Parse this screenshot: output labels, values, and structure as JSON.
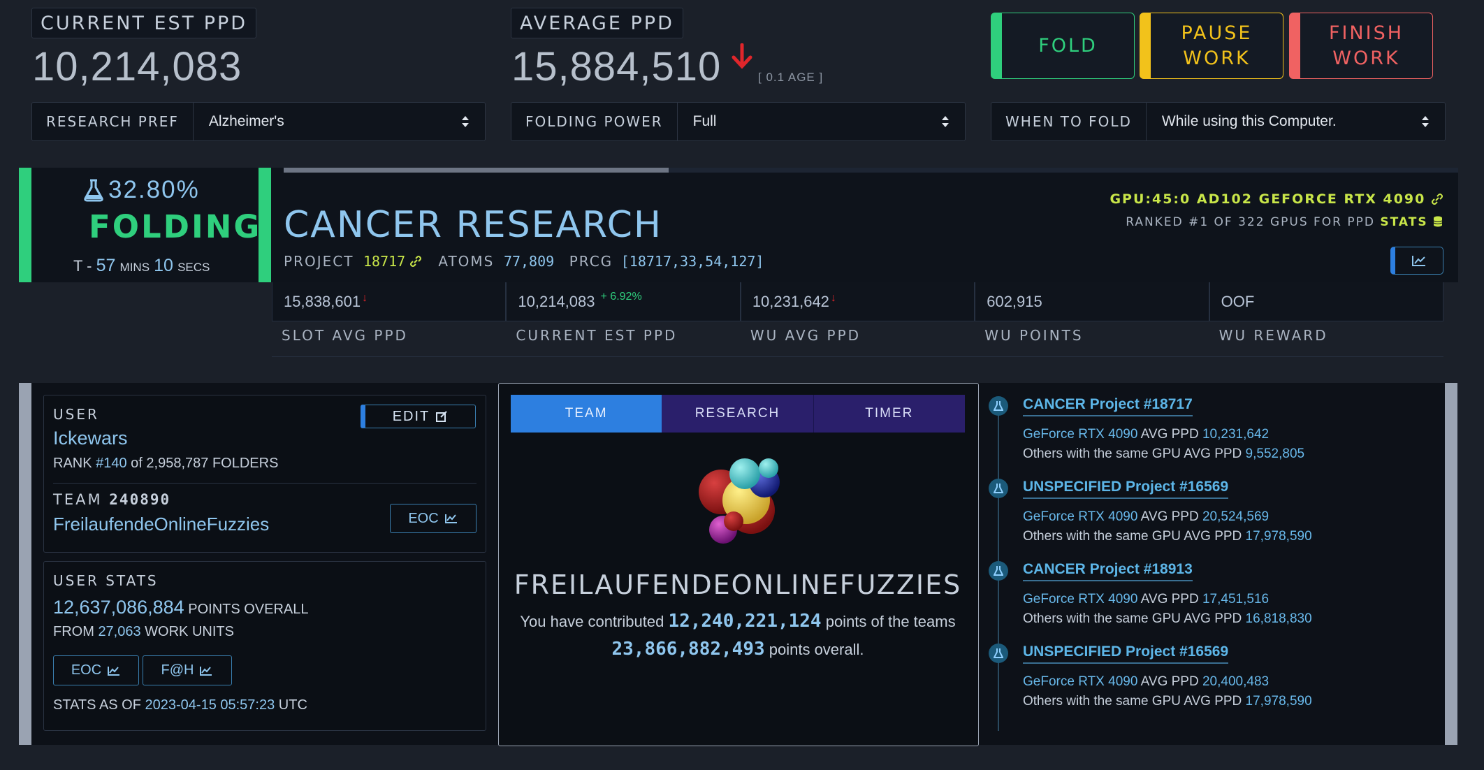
{
  "header": {
    "current_est_ppd_label": "CURRENT EST PPD",
    "current_est_ppd_value": "10,214,083",
    "average_ppd_label": "AVERAGE PPD",
    "average_ppd_value": "15,884,510",
    "average_age": "[ 0.1 AGE ]",
    "research_pref_label": "RESEARCH PREF",
    "research_pref_value": "Alzheimer's",
    "folding_power_label": "FOLDING POWER",
    "folding_power_value": "Full",
    "when_to_fold_label": "WHEN TO FOLD",
    "when_to_fold_value": "While using this Computer."
  },
  "controls": {
    "fold": "FOLD",
    "pause": "PAUSE WORK",
    "finish": "FINISH WORK"
  },
  "status": {
    "percent": "32.80%",
    "state": "FOLDING",
    "eta_prefix": "T - ",
    "eta_mins": "57",
    "eta_mins_unit": "MINS",
    "eta_secs": "10",
    "eta_secs_unit": "SECS",
    "progress_fraction": 0.328
  },
  "research": {
    "title": "CANCER RESEARCH",
    "project_label": "PROJECT",
    "project_value": "18717",
    "atoms_label": "ATOMS",
    "atoms_value": "77,809",
    "prcg_label": "PRCG",
    "prcg_value": "[18717,33,54,127]",
    "gpu": "GPU:45:0 AD102 GEFORCE RTX 4090",
    "ranked": "RANKED #1 OF 322 GPUS FOR PPD",
    "stats_link": "STATS"
  },
  "slot_stats": {
    "values": [
      "15,838,601",
      "10,214,083",
      "10,231,642",
      "602,915",
      "OOF"
    ],
    "current_change": "+ 6.92%",
    "labels": [
      "SLOT AVG PPD",
      "CURRENT EST PPD",
      "WU AVG PPD",
      "WU POINTS",
      "WU REWARD"
    ]
  },
  "user": {
    "title": "USER",
    "edit": "EDIT",
    "name": "Ickewars",
    "rank_prefix": "RANK ",
    "rank_value": "#140",
    "rank_suffix": " of 2,958,787 FOLDERS",
    "team_label": "TEAM",
    "team_id": "240890",
    "team_name": "FreilaufendeOnlineFuzzies",
    "eoc": "EOC"
  },
  "user_stats": {
    "title": "USER STATS",
    "points": "12,637,086,884",
    "points_suffix": " POINTS OVERALL",
    "from_prefix": "FROM ",
    "work_units": "27,063",
    "wu_suffix": " WORK UNITS",
    "eoc": "EOC",
    "fah": "F@H",
    "stats_as_of_prefix": "STATS AS OF ",
    "stats_as_of": "2023-04-15 05:57:23",
    "tz": " UTC"
  },
  "team_panel": {
    "tabs": [
      "TEAM",
      "RESEARCH",
      "TIMER"
    ],
    "team_name": "FREILAUFENDEONLINEFUZZIES",
    "contrib_prefix": "You have contributed ",
    "contrib_value": "12,240,221,124",
    "contrib_suffix": " points of the teams",
    "team_total": "23,866,882,493",
    "team_total_suffix": " points overall."
  },
  "projects": [
    {
      "title": "CANCER Project #18717",
      "gpu": "GeForce RTX 4090",
      "avg_label": " AVG PPD ",
      "avg": "10,231,642",
      "others_label": "Others with the same GPU AVG PPD ",
      "others": "9,552,805"
    },
    {
      "title": "UNSPECIFIED Project #16569",
      "gpu": "GeForce RTX 4090",
      "avg_label": " AVG PPD ",
      "avg": "20,524,569",
      "others_label": "Others with the same GPU AVG PPD ",
      "others": "17,978,590"
    },
    {
      "title": "CANCER Project #18913",
      "gpu": "GeForce RTX 4090",
      "avg_label": " AVG PPD ",
      "avg": "17,451,516",
      "others_label": "Others with the same GPU AVG PPD ",
      "others": "16,818,830"
    },
    {
      "title": "UNSPECIFIED Project #16569",
      "gpu": "GeForce RTX 4090",
      "avg_label": " AVG PPD ",
      "avg": "20,400,483",
      "others_label": "Others with the same GPU AVG PPD ",
      "others": "17,978,590"
    }
  ],
  "colors": {
    "accent_green": "#2fcf7d",
    "pause_yellow": "#f2c21b",
    "finish_red": "#f06262",
    "link_blue": "#68b8ea"
  }
}
